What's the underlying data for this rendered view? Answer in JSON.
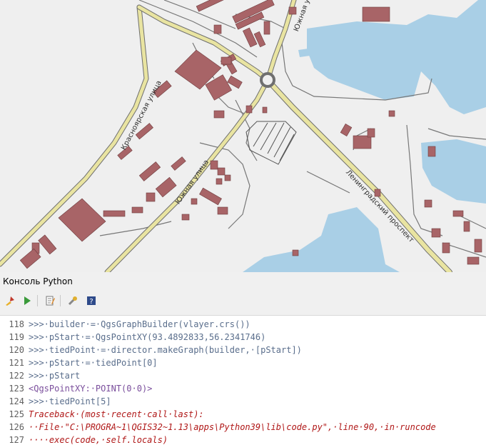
{
  "map": {
    "street_labels": [
      "Красноярская улица",
      "Южная улица",
      "Южная улица",
      "Ленинградский проспект"
    ],
    "colors": {
      "background": "#efefef",
      "water": "#a9cfe6",
      "building": "#a86467",
      "road_main": "#e9e4a1",
      "road_casing": "#6f6f6f"
    }
  },
  "panel": {
    "title": "Консоль Python",
    "toolbar": [
      {
        "name": "clear-console-icon",
        "tooltip": "clear"
      },
      {
        "name": "run-command-icon",
        "tooltip": "run"
      },
      {
        "name": "show-editor-icon",
        "tooltip": "editor"
      },
      {
        "name": "options-icon",
        "tooltip": "options"
      },
      {
        "name": "help-icon",
        "tooltip": "help"
      }
    ]
  },
  "console": {
    "lines": [
      {
        "num": "118",
        "text": ">>>·builder·=·QgsGraphBuilder(vlayer.crs())",
        "kind": "input"
      },
      {
        "num": "119",
        "text": ">>>·pStart·=·QgsPointXY(93.4892833,56.2341746)",
        "kind": "input"
      },
      {
        "num": "120",
        "text": ">>>·tiedPoint·=·director.makeGraph(builder,·[pStart])",
        "kind": "input"
      },
      {
        "num": "121",
        "text": ">>>·pStart·=·tiedPoint[0]",
        "kind": "input"
      },
      {
        "num": "122",
        "text": ">>>·pStart",
        "kind": "input"
      },
      {
        "num": "123",
        "text": "<QgsPointXY:·POINT(0·0)>",
        "kind": "output"
      },
      {
        "num": "124",
        "text": ">>>·tiedPoint[5]",
        "kind": "input"
      },
      {
        "num": "125",
        "text": "Traceback·(most·recent·call·last):",
        "kind": "error"
      },
      {
        "num": "126",
        "text": "··File·\"C:\\PROGRA~1\\QGIS32~1.13\\apps\\Python39\\lib\\code.py\",·line·90,·in·runcode",
        "kind": "error"
      },
      {
        "num": "127",
        "text": "····exec(code,·self.locals)",
        "kind": "error"
      }
    ]
  }
}
